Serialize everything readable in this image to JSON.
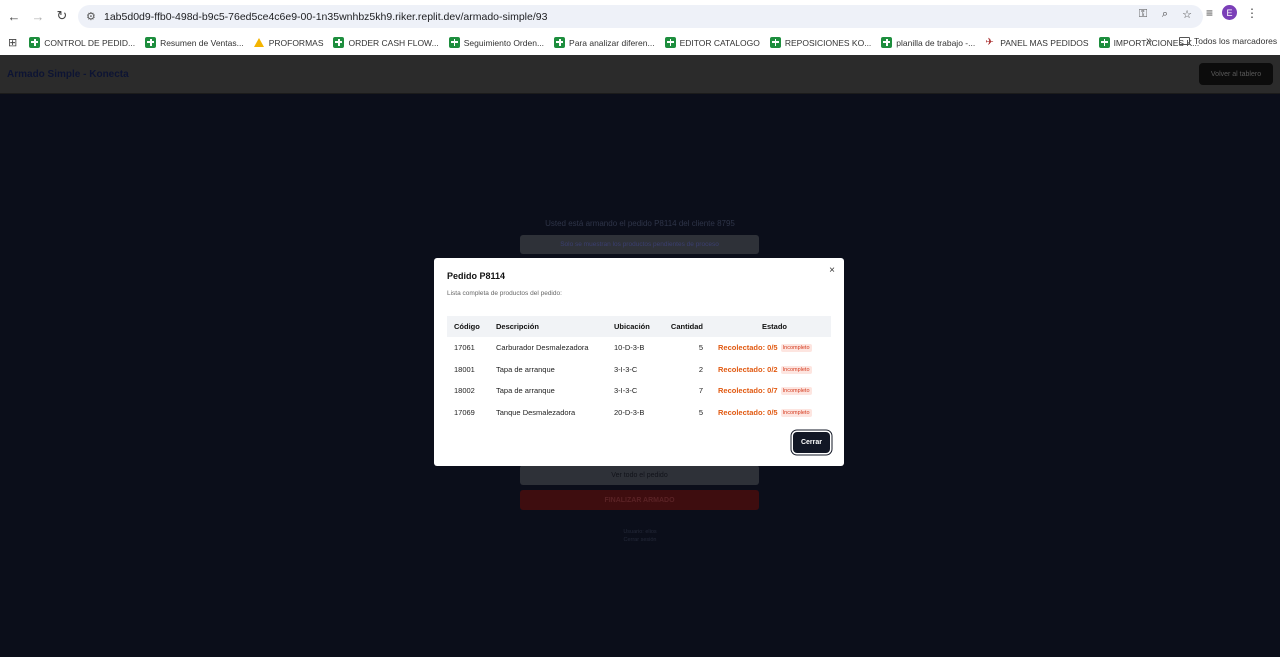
{
  "browser": {
    "url": "1ab5d0d9-ffb0-498d-b9c5-76ed5ce4c6e9-00-1n35wnhbz5kh9.riker.replit.dev/armado-simple/93",
    "profile_initial": "E",
    "bookmarks": [
      {
        "label": "CONTROL DE PEDID...",
        "icon": "sheets-icon"
      },
      {
        "label": "Resumen de Ventas...",
        "icon": "sheets-icon"
      },
      {
        "label": "PROFORMAS",
        "icon": "drive-icon"
      },
      {
        "label": "ORDER CASH FLOW...",
        "icon": "sheets-icon"
      },
      {
        "label": "Seguimiento Orden...",
        "icon": "sheets-icon"
      },
      {
        "label": "Para analizar diferen...",
        "icon": "sheets-icon"
      },
      {
        "label": "EDITOR CATALOGO",
        "icon": "sheets-icon"
      },
      {
        "label": "REPOSICIONES KO...",
        "icon": "sheets-icon"
      },
      {
        "label": "planilla de trabajo -...",
        "icon": "sheets-icon"
      },
      {
        "label": "PANEL MAS PEDIDOS",
        "icon": "plane-icon"
      },
      {
        "label": "IMPORTACIONES K...",
        "icon": "sheets-icon"
      }
    ],
    "more_label": "»",
    "all_bookmarks_label": "Todos los marcadores"
  },
  "app": {
    "title": "Armado Simple - Konecta",
    "back_button": "Volver al tablero",
    "info_text": "Usted está armando el pedido P8114 del cliente 8795",
    "banner_text": "Solo se muestran los productos pendientes de proceso",
    "view_all_button": "Ver todo el pedido",
    "finalize_button": "FINALIZAR ARMADO",
    "user_line": "Usuario: elios",
    "logout_link": "Cerrar sesión"
  },
  "modal": {
    "title": "Pedido P8114",
    "subtitle": "Lista completa de productos del pedido:",
    "close_icon": "×",
    "columns": [
      "Código",
      "Descripción",
      "Ubicación",
      "Cantidad",
      "Estado"
    ],
    "rows": [
      {
        "code": "17061",
        "description": "Carburador Desmalezadora",
        "location": "10-D-3-B",
        "quantity": "5",
        "status": "Recolectado: 0/5",
        "badge": "Incompleto"
      },
      {
        "code": "18001",
        "description": "Tapa de arranque",
        "location": "3-I-3-C",
        "quantity": "2",
        "status": "Recolectado: 0/2",
        "badge": "Incompleto"
      },
      {
        "code": "18002",
        "description": "Tapa de arranque",
        "location": "3-I-3-C",
        "quantity": "7",
        "status": "Recolectado: 0/7",
        "badge": "Incompleto"
      },
      {
        "code": "17069",
        "description": "Tanque Desmalezadora",
        "location": "20-D-3-B",
        "quantity": "5",
        "status": "Recolectado: 0/5",
        "badge": "Incompleto"
      }
    ],
    "close_button": "Cerrar"
  },
  "colors": {
    "status_orange": "#e15a12",
    "badge_bg": "#fde5e0",
    "primary_dark": "#121725",
    "overlay": "#0b0e1a"
  }
}
